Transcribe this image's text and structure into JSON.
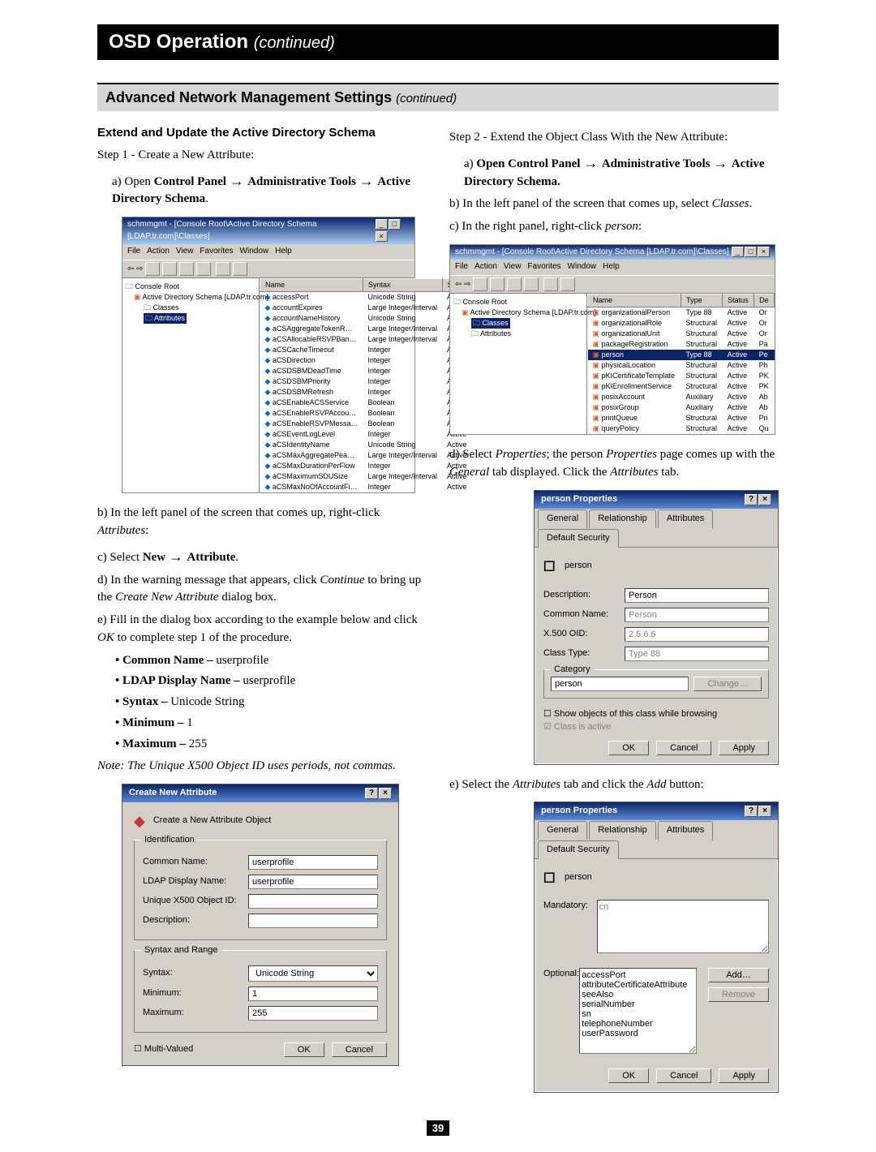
{
  "header": {
    "main": "OSD Operation",
    "main_cont": "(continued)",
    "sub": "Advanced Network Management Settings",
    "sub_cont": "(continued)"
  },
  "left": {
    "heading": "Extend and Update the Active Directory Schema",
    "step1": "Step 1 - Create a New Attribute:",
    "a_pre": "a) Open ",
    "a_b1": "Control Panel",
    "a_b2": "Administrative Tools",
    "a_b3": "Active Directory Schema",
    "shot1": {
      "title": "schmmgmt - [Console Root\\Active Directory Schema [LDAP.tr.com]\\Classes]",
      "menu": [
        "File",
        "Action",
        "View",
        "Favorites",
        "Window",
        "Help"
      ],
      "tree": {
        "root": "Console Root",
        "l1": "Active Directory Schema [LDAP.tr.com]",
        "l2a": "Classes",
        "l2b_sel": "Attributes"
      },
      "cols": [
        "Name",
        "Syntax",
        "Status"
      ],
      "rows": [
        [
          "accessPort",
          "Unicode String",
          "Active"
        ],
        [
          "accountExpires",
          "Large Integer/Interval",
          "Active"
        ],
        [
          "accountNameHistory",
          "Unicode String",
          "Active"
        ],
        [
          "aCSAggregateTokenR…",
          "Large Integer/Interval",
          "Active"
        ],
        [
          "aCSAllocableRSVPBan…",
          "Large Integer/Interval",
          "Active"
        ],
        [
          "aCSCacheTimeout",
          "Integer",
          "Active"
        ],
        [
          "aCSDirection",
          "Integer",
          "Active"
        ],
        [
          "aCSDSBMDeadTime",
          "Integer",
          "Active"
        ],
        [
          "aCSDSBMPriority",
          "Integer",
          "Active"
        ],
        [
          "aCSDSBMRefresh",
          "Integer",
          "Active"
        ],
        [
          "aCSEnableACSService",
          "Boolean",
          "Active"
        ],
        [
          "aCSEnableRSVPAccou…",
          "Boolean",
          "Active"
        ],
        [
          "aCSEnableRSVPMessa…",
          "Boolean",
          "Active"
        ],
        [
          "aCSEventLogLevel",
          "Integer",
          "Active"
        ],
        [
          "aCSIdentityName",
          "Unicode String",
          "Active"
        ],
        [
          "aCSMaxAggregatePea…",
          "Large Integer/Interval",
          "Active"
        ],
        [
          "aCSMaxDurationPerFlow",
          "Integer",
          "Active"
        ],
        [
          "aCSMaximumSDUSize",
          "Large Integer/Interval",
          "Active"
        ],
        [
          "aCSMaxNoOfAccountFi…",
          "Integer",
          "Active"
        ]
      ]
    },
    "b": "b) In the left panel of the screen that comes up, right-click ",
    "b_i": "Attributes",
    "c_pre": "c) Select ",
    "c_b1": "New",
    "c_b2": "Attribute",
    "d1": "d) In the warning message that appears, click ",
    "d_i": "Continue",
    "d2": " to bring up the ",
    "d_ib": "Create New Attribute",
    "d3": " dialog box.",
    "e1": "e) Fill in the dialog box according to the example below and click ",
    "e_i": "OK",
    "e2": " to complete step 1 of the procedure.",
    "bul1_b": "Common Name – ",
    "bul1_t": "userprofile",
    "bul2_b": "LDAP Display Name – ",
    "bul2_t": "userprofile",
    "bul3_b": "Syntax – ",
    "bul3_t": "Unicode String",
    "bul4_b": "Minimum – ",
    "bul4_t": "1",
    "bul5_b": "Maximum – ",
    "bul5_t": "255",
    "note": "Note: The Unique X500 Object ID uses periods, not commas.",
    "dlg1": {
      "title": "Create New Attribute",
      "top": "Create a New Attribute Object",
      "grp1": "Identification",
      "lab_cn": "Common Name:",
      "lab_ldap": "LDAP Display Name:",
      "lab_oid": "Unique X500 Object ID:",
      "lab_desc": "Description:",
      "grp2": "Syntax and Range",
      "lab_syn": "Syntax:",
      "lab_min": "Minimum:",
      "lab_max": "Maximum:",
      "val_cn": "userprofile",
      "val_ldap": "userprofile",
      "val_syn": "Unicode String",
      "val_min": "1",
      "val_max": "255",
      "chk": "Multi-Valued",
      "ok": "OK",
      "cancel": "Cancel"
    }
  },
  "right": {
    "step2": "Step 2 - Extend the Object Class With the New Attribute:",
    "a_pre": "a) ",
    "a_b0_pre": "Open ",
    "a_b1": "Control Panel",
    "a_b2": "Administrative Tools",
    "a_b3": "Active Directory Schema",
    "b": "b) In the left panel of the screen that comes up, select ",
    "b_i": "Classes",
    "c": "c) In the right panel, right-click ",
    "c_i": "person",
    "shot2": {
      "title": "schmmgmt - [Console Root\\Active Directory Schema [LDAP.tr.com]\\Classes]",
      "menu": [
        "File",
        "Action",
        "View",
        "Favorites",
        "Window",
        "Help"
      ],
      "tree": {
        "root": "Console Root",
        "l1": "Active Directory Schema [LDAP.tr.com]",
        "l2a_sel": "Classes",
        "l2b": "Attributes"
      },
      "cols": [
        "Name",
        "Type",
        "Status",
        "De"
      ],
      "rows": [
        [
          "organizationalPerson",
          "Type 88",
          "Active",
          "Or"
        ],
        [
          "organizationalRole",
          "Structural",
          "Active",
          "Or"
        ],
        [
          "organizationalUnit",
          "Structural",
          "Active",
          "Or"
        ],
        [
          "packageRegistration",
          "Structural",
          "Active",
          "Pa"
        ]
      ],
      "selrow": [
        "person",
        "Type 88",
        "Active",
        "Pe"
      ],
      "rows2": [
        [
          "physicalLocation",
          "Structural",
          "Active",
          "Ph"
        ],
        [
          "pKICertificateTemplate",
          "Structural",
          "Active",
          "PK"
        ],
        [
          "pKIEnrollmentService",
          "Structural",
          "Active",
          "PK"
        ],
        [
          "posixAccount",
          "Auxiliary",
          "Active",
          "Ab"
        ],
        [
          "posixGroup",
          "Auxiliary",
          "Active",
          "Ab"
        ],
        [
          "printQueue",
          "Structural",
          "Active",
          "Pri"
        ],
        [
          "queryPolicy",
          "Structural",
          "Active",
          "Qu"
        ]
      ]
    },
    "d1": "d) Select ",
    "d_i1": "Properties",
    "d2": "; the person ",
    "d_i2": "Properties",
    "d3": " page comes up with the ",
    "d_i3": "General",
    "d4": " tab displayed. Click the ",
    "d_i4": "Attributes",
    "d5": " tab.",
    "dlg2": {
      "title": "person Properties",
      "tabs": [
        "General",
        "Relationship",
        "Attributes",
        "Default Security"
      ],
      "active": 0,
      "icon_label": "person",
      "lab_desc": "Description:",
      "lab_cn": "Common Name:",
      "lab_oid": "X.500 OID:",
      "lab_ct": "Class Type:",
      "lab_cat": "Category",
      "val_desc": "Person",
      "val_cn": "Person",
      "val_oid": "2.5.6.6",
      "val_ct": "Type 88",
      "val_cat": "person",
      "chk_show": "Show objects of this class while browsing",
      "chk_active": "Class is active",
      "change": "Change…",
      "ok": "OK",
      "cancel": "Cancel",
      "apply": "Apply"
    },
    "e": "e) Select the ",
    "e_i": "Attributes",
    "e2": " tab and click the ",
    "e_i2": "Add",
    "e3": " button:",
    "dlg3": {
      "title": "person Properties",
      "tabs": [
        "General",
        "Relationship",
        "Attributes",
        "Default Security"
      ],
      "active": 2,
      "icon_label": "person",
      "lab_mand": "Mandatory:",
      "lab_opt": "Optional:",
      "mand": "cn",
      "opt": "accessPort\nattributeCertificateAttribute\nseeAlso\nserialNumber\nsn\ntelephoneNumber\nuserPassword",
      "add": "Add…",
      "remove": "Remove",
      "ok": "OK",
      "cancel": "Cancel",
      "apply": "Apply"
    }
  },
  "page_number": "39"
}
